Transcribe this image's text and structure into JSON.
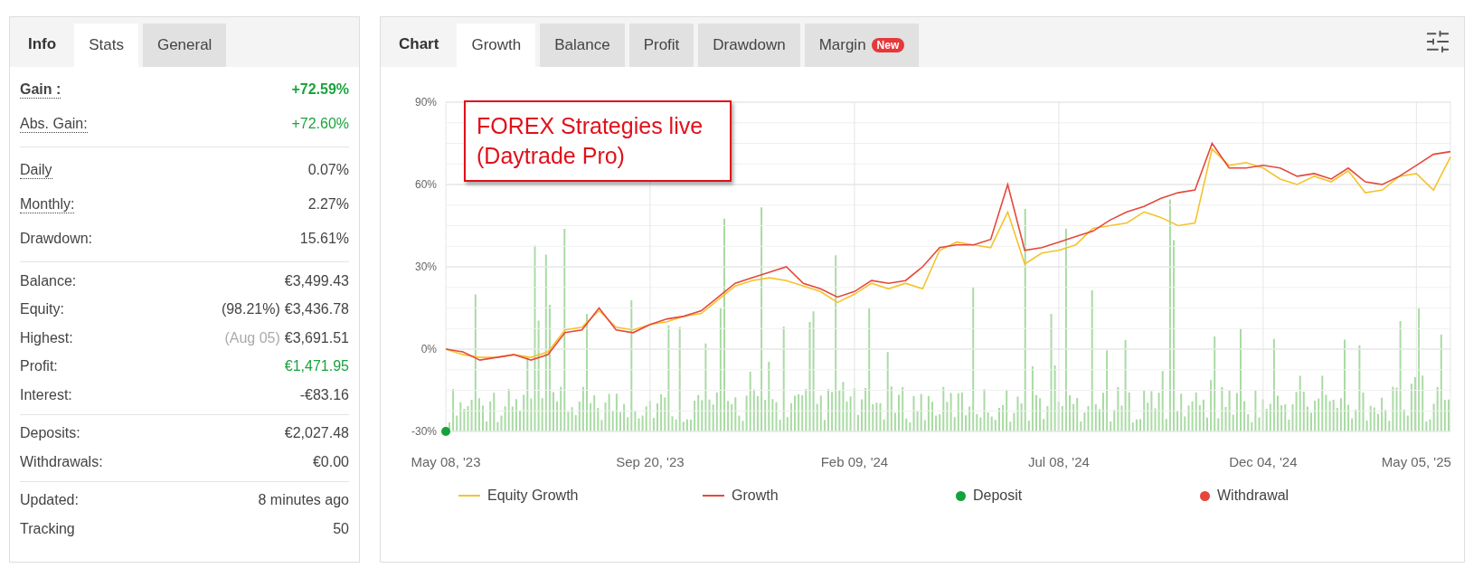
{
  "stats_panel": {
    "heading": "Info",
    "tabs": [
      {
        "label": "Stats",
        "selected": true
      },
      {
        "label": "General",
        "selected": false
      }
    ],
    "groups": [
      {
        "rows": [
          {
            "label": "Gain :",
            "value": "+72.59%",
            "positive": true,
            "dotted": true,
            "bold": true
          },
          {
            "label": "Abs. Gain:",
            "value": "+72.60%",
            "positive": true,
            "dotted": true,
            "bold": false
          }
        ]
      },
      {
        "rows": [
          {
            "label": "Daily",
            "value": "0.07%",
            "positive": false,
            "dotted": true,
            "bold": false
          },
          {
            "label": "Monthly:",
            "value": "2.27%",
            "positive": false,
            "dotted": true,
            "bold": false
          },
          {
            "label": "Drawdown:",
            "value": "15.61%",
            "positive": false,
            "dotted": false,
            "bold": false
          }
        ]
      },
      {
        "rows": [
          {
            "label": "Balance:",
            "value": "€3,499.43",
            "positive": false,
            "dotted": false,
            "bold": false
          },
          {
            "label": "Equity:",
            "note": "(98.21%)",
            "note_muted": false,
            "value": "€3,436.78",
            "positive": false,
            "dotted": false,
            "bold": false
          },
          {
            "label": "Highest:",
            "note": "(Aug 05)",
            "note_muted": true,
            "value": "€3,691.51",
            "positive": false,
            "dotted": false,
            "bold": false
          },
          {
            "label": "Profit:",
            "value": "€1,471.95",
            "positive": true,
            "dotted": false,
            "bold": false
          },
          {
            "label": "Interest:",
            "value": "-€83.16",
            "positive": false,
            "dotted": false,
            "bold": false
          }
        ]
      },
      {
        "rows": [
          {
            "label": "Deposits:",
            "value": "€2,027.48",
            "positive": false,
            "dotted": false,
            "bold": false
          },
          {
            "label": "Withdrawals:",
            "value": "€0.00",
            "positive": false,
            "dotted": false,
            "bold": false
          }
        ]
      },
      {
        "rows": [
          {
            "label": "Updated:",
            "value": "8 minutes ago",
            "positive": false,
            "dotted": false,
            "bold": false
          },
          {
            "label": "Tracking",
            "value": "50",
            "positive": false,
            "dotted": false,
            "bold": false
          }
        ]
      }
    ]
  },
  "chart_panel": {
    "heading": "Chart",
    "tabs": [
      {
        "label": "Growth",
        "selected": true
      },
      {
        "label": "Balance",
        "selected": false
      },
      {
        "label": "Profit",
        "selected": false
      },
      {
        "label": "Drawdown",
        "selected": false
      },
      {
        "label": "Margin",
        "selected": false,
        "badge": "New"
      }
    ],
    "overlay_note": {
      "lines": [
        "FOREX Strategies live",
        "(Daytrade Pro)"
      ]
    },
    "chart_data": {
      "type": "line",
      "categories": [
        "May 08, '23",
        null,
        null,
        null,
        null,
        null,
        null,
        null,
        null,
        null,
        null,
        null,
        "Sep 20, '23",
        null,
        null,
        null,
        null,
        null,
        null,
        null,
        null,
        null,
        null,
        null,
        "Feb 09, '24",
        null,
        null,
        null,
        null,
        null,
        null,
        null,
        null,
        null,
        null,
        null,
        "Jul 08, '24",
        null,
        null,
        null,
        null,
        null,
        null,
        null,
        null,
        null,
        null,
        null,
        "Dec 04, '24",
        null,
        null,
        null,
        null,
        null,
        null,
        null,
        null,
        "May 05, '25",
        null,
        null
      ],
      "grid": true,
      "yticks": [
        {
          "value": -30,
          "label": "-30%"
        },
        {
          "value": 0,
          "label": "0%"
        },
        {
          "value": 30,
          "label": "30%"
        },
        {
          "value": 60,
          "label": "60%"
        },
        {
          "value": 90,
          "label": "90%"
        }
      ],
      "ylim": [
        -30,
        90
      ],
      "series": [
        {
          "name": "Equity Growth",
          "color": "#f5c32c",
          "values": [
            0,
            -2,
            -3,
            -3,
            -2,
            -3,
            -1,
            7,
            8,
            14,
            8,
            7,
            9,
            10,
            12,
            13,
            18,
            23,
            25,
            26,
            25,
            23,
            21,
            17,
            20,
            24,
            22,
            24,
            22,
            36,
            39,
            38,
            37,
            50,
            31,
            35,
            36,
            38,
            44,
            45,
            46,
            50,
            48,
            45,
            46,
            73,
            67,
            68,
            66,
            62,
            60,
            63,
            61,
            65,
            57,
            58,
            63,
            64,
            58,
            70
          ]
        },
        {
          "name": "Growth",
          "color": "#e5483b",
          "values": [
            0,
            -1,
            -4,
            -3,
            -2,
            -4,
            -2,
            6,
            7,
            15,
            7,
            6,
            9,
            11,
            12,
            14,
            19,
            24,
            26,
            28,
            30,
            24,
            22,
            19,
            21,
            25,
            24,
            25,
            30,
            37,
            38,
            38,
            40,
            60,
            36,
            37,
            39,
            41,
            43,
            47,
            50,
            52,
            55,
            57,
            58,
            75,
            66,
            66,
            67,
            66,
            63,
            64,
            62,
            66,
            61,
            60,
            63,
            67,
            71,
            72
          ]
        }
      ]
    },
    "markers": [
      {
        "kind": "deposit",
        "color": "#12a33b"
      }
    ],
    "legend": [
      {
        "label": "Deposit",
        "kind": "dot",
        "color": "#12a33b"
      },
      {
        "label": "Withdrawal",
        "kind": "dot",
        "color": "#e8453a"
      }
    ]
  }
}
